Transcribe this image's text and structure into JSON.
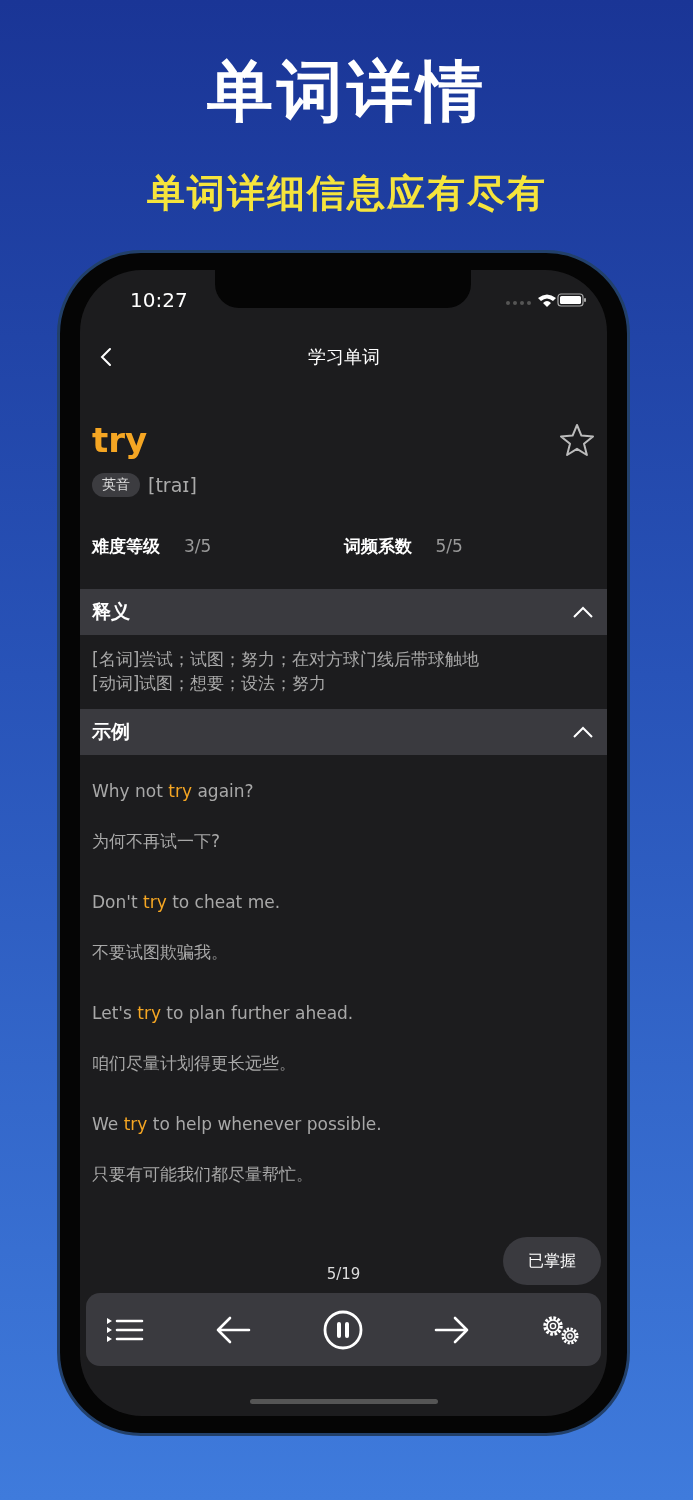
{
  "headline": "单词详情",
  "subheadline": "单词详细信息应有尽有",
  "status_bar": {
    "time": "10:27"
  },
  "nav": {
    "title": "学习单词"
  },
  "word": {
    "text": "try",
    "favorited": false,
    "accent": "英音",
    "phonetic": "[traɪ]"
  },
  "stats": [
    {
      "label": "难度等级",
      "value": "3/5"
    },
    {
      "label": "词频系数",
      "value": "5/5"
    }
  ],
  "sections": [
    {
      "kind": "definitions",
      "title": "释义",
      "expanded": true,
      "lines": [
        "[名词]尝试；试图；努力；在对方球门线后带球触地",
        "[动词]试图；想要；设法；努力"
      ]
    },
    {
      "kind": "examples",
      "title": "示例",
      "expanded": true,
      "examples": [
        {
          "before": "Why not ",
          "word": "try",
          "after": " again?",
          "zh": "为何不再试一下?"
        },
        {
          "before": "Don't ",
          "word": "try",
          "after": " to cheat me.",
          "zh": "不要试图欺骗我。"
        },
        {
          "before": "Let's ",
          "word": "try",
          "after": " to plan further ahead.",
          "zh": "咱们尽量计划得更长远些。"
        },
        {
          "before": "We ",
          "word": "try",
          "after": " to help whenever possible.",
          "zh": "只要有可能我们都尽量帮忙。"
        }
      ]
    }
  ],
  "mastered_button": "已掌握",
  "progress": "5/19",
  "player": {
    "playing": true
  }
}
